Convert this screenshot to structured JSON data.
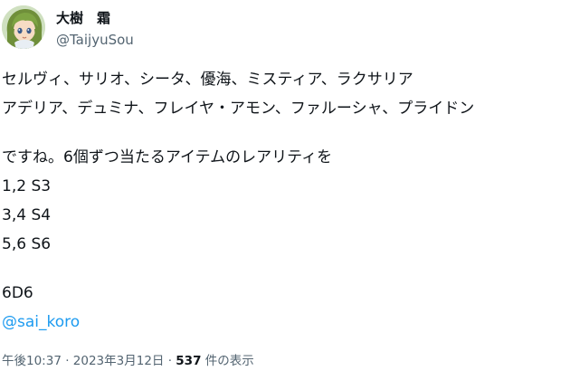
{
  "user": {
    "display_name": "大樹　霜",
    "handle": "@TaijyuSou"
  },
  "tweet": {
    "line1": "セルヴィ、サリオ、シータ、優海、ミスティア、ラクサリア",
    "line2": "アデリア、デュミナ、フレイヤ・アモン、ファルーシャ、プライドン",
    "line3": "ですね。6個ずつ当たるアイテムのレアリティを",
    "line4": "1,2 S3",
    "line5": "3,4 S4",
    "line6": "5,6 S6",
    "line7": "6D6",
    "mention": "@sai_koro"
  },
  "meta": {
    "time": "午後10:37",
    "separator": " · ",
    "date": "2023年3月12日",
    "views_count": "537",
    "views_label": " 件の表示"
  },
  "colors": {
    "text": "#0f1419",
    "secondary": "#536471",
    "link": "#1d9bf0"
  },
  "icons": {
    "avatar": "anime-character-avatar"
  }
}
